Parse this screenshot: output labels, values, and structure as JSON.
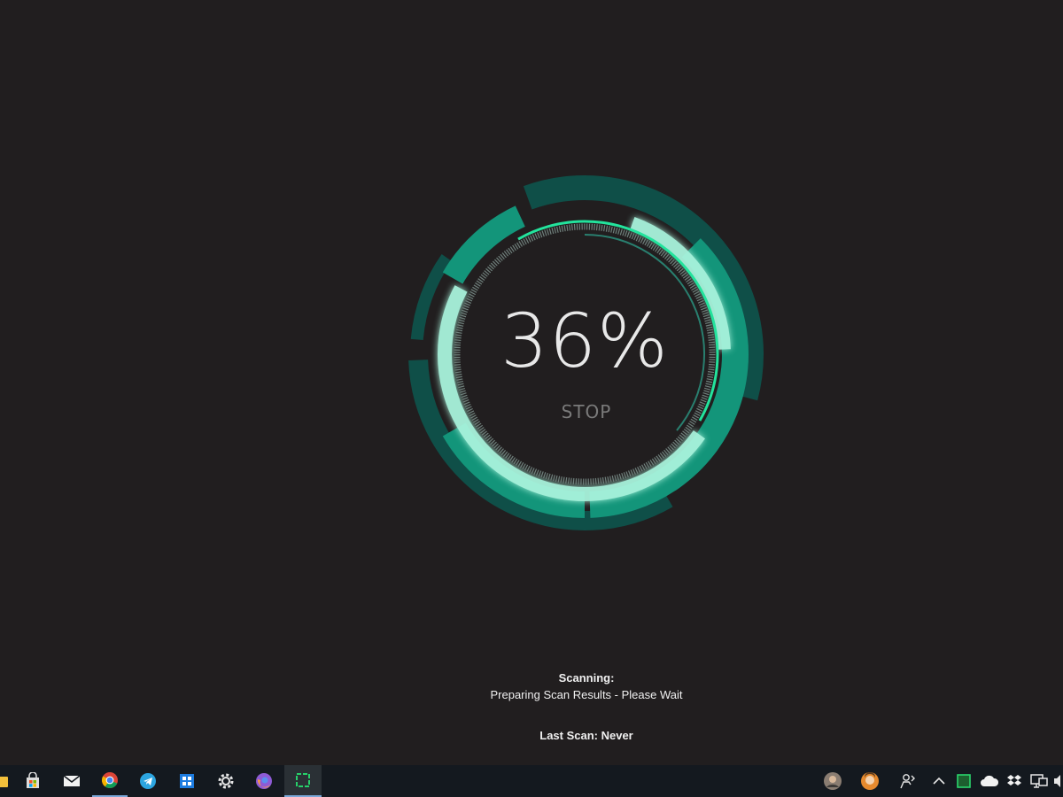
{
  "scan": {
    "percent_label": "36%",
    "progress_fraction": 0.36,
    "stop_label": "STOP",
    "status_title": "Scanning:",
    "status_detail": "Preparing Scan Results - Please Wait",
    "last_scan": "Last Scan: Never"
  },
  "colors": {
    "background": "#211e1f",
    "ring_dark": "#0f4f48",
    "ring_mid": "#13957a",
    "ring_light": "#a8f3dc",
    "ring_accent": "#23e39c",
    "taskbar": "#14191f"
  },
  "taskbar": {
    "apps": [
      {
        "icon": "file-explorer-icon"
      },
      {
        "icon": "store-icon"
      },
      {
        "icon": "mail-icon"
      },
      {
        "icon": "chrome-icon"
      },
      {
        "icon": "telegram-icon"
      },
      {
        "icon": "app-grid-icon"
      },
      {
        "icon": "settings-icon"
      },
      {
        "icon": "firefox-icon"
      },
      {
        "icon": "scanner-app-icon"
      }
    ],
    "tray": [
      {
        "icon": "contact-avatar-icon"
      },
      {
        "icon": "contact-avatar-icon"
      },
      {
        "icon": "people-icon"
      },
      {
        "icon": "chevron-up-icon"
      },
      {
        "icon": "scanner-tray-icon"
      },
      {
        "icon": "onedrive-icon"
      },
      {
        "icon": "dropbox-icon"
      },
      {
        "icon": "network-icon"
      }
    ]
  }
}
